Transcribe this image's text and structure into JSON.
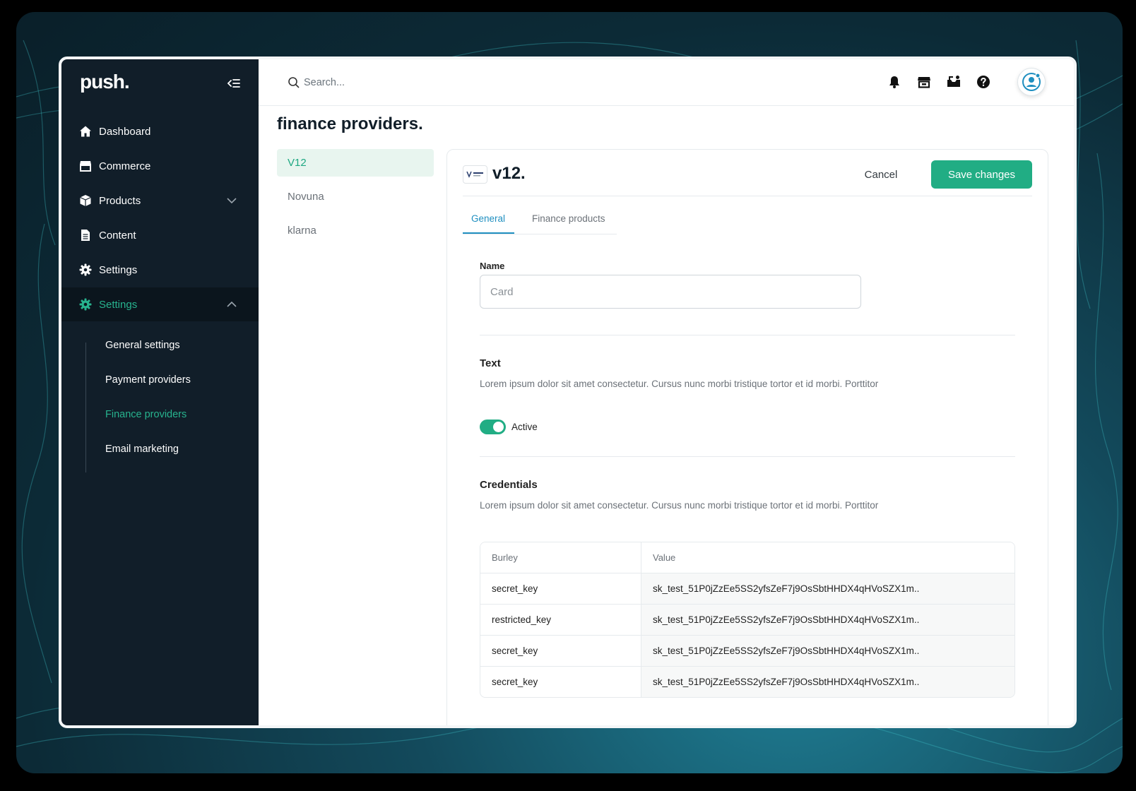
{
  "sidebar": {
    "logo": "push.",
    "nav": [
      {
        "label": "Dashboard",
        "icon": "home-icon"
      },
      {
        "label": "Commerce",
        "icon": "store-icon"
      },
      {
        "label": "Products",
        "icon": "box-icon"
      },
      {
        "label": "Content",
        "icon": "document-icon"
      },
      {
        "label": "Settings",
        "icon": "gear-icon"
      },
      {
        "label": "Settings",
        "icon": "gear-icon"
      }
    ],
    "subnav": [
      {
        "label": "General settings"
      },
      {
        "label": "Payment providers"
      },
      {
        "label": "Finance providers"
      },
      {
        "label": "Email marketing"
      }
    ],
    "active_sub": "Finance providers"
  },
  "topbar": {
    "search_placeholder": "Search...",
    "icons": [
      "bell-icon",
      "store-icon",
      "inbox-icon",
      "help-icon",
      "user-avatar-icon"
    ]
  },
  "page": {
    "title": "finance providers.",
    "providers": [
      {
        "label": "V12"
      },
      {
        "label": "Novuna"
      },
      {
        "label": "klarna"
      }
    ],
    "active_provider": "V12"
  },
  "card": {
    "title": "v12.",
    "cancel_label": "Cancel",
    "save_label": "Save changes",
    "tabs": [
      {
        "label": "General"
      },
      {
        "label": "Finance products"
      }
    ],
    "active_tab": "General",
    "name_label": "Name",
    "name_placeholder": "Card",
    "text_title": "Text",
    "text_desc": "Lorem ipsum dolor sit amet consectetur. Cursus nunc morbi tristique tortor et id morbi. Porttitor",
    "toggle_label": "Active",
    "toggle_on": true,
    "credentials_title": "Credentials",
    "credentials_desc": "Lorem ipsum dolor sit amet consectetur. Cursus nunc morbi tristique tortor et id morbi. Porttitor",
    "table": {
      "headers": [
        "Burley",
        "Value"
      ],
      "rows": [
        [
          "secret_key",
          "sk_test_51P0jZzEe5SS2yfsZeF7j9OsSbtHHDX4qHVoSZX1m.."
        ],
        [
          "restricted_key",
          "sk_test_51P0jZzEe5SS2yfsZeF7j9OsSbtHHDX4qHVoSZX1m.."
        ],
        [
          "secret_key",
          "sk_test_51P0jZzEe5SS2yfsZeF7j9OsSbtHHDX4qHVoSZX1m.."
        ],
        [
          "secret_key",
          "sk_test_51P0jZzEe5SS2yfsZeF7j9OsSbtHHDX4qHVoSZX1m.."
        ]
      ]
    }
  },
  "colors": {
    "accent": "#21ad84",
    "sidebar_bg": "#111e29",
    "tab_active": "#1f8fc0"
  }
}
